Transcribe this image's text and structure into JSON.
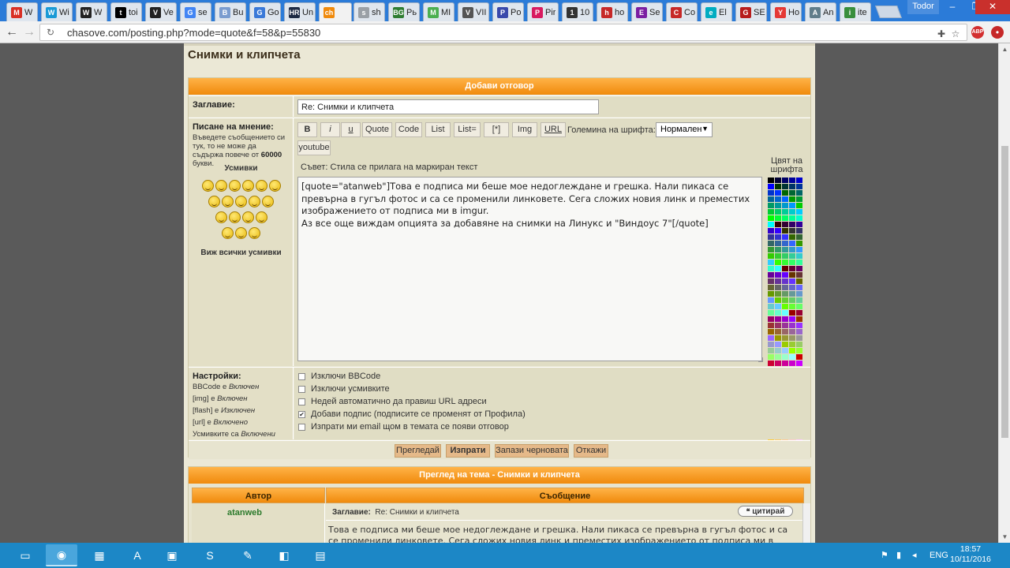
{
  "browser": {
    "tabs": [
      {
        "title": "W",
        "icon": "M",
        "color": "#d93025"
      },
      {
        "title": "Wi",
        "icon": "W",
        "color": "#1a9ad6"
      },
      {
        "title": "W",
        "icon": "W",
        "color": "#222222"
      },
      {
        "title": "toi",
        "icon": "t",
        "color": "#000000"
      },
      {
        "title": "Ve",
        "icon": "V",
        "color": "#222222"
      },
      {
        "title": "se",
        "icon": "G",
        "color": "#4285f4"
      },
      {
        "title": "Bu",
        "icon": "B",
        "color": "#7a9ccf"
      },
      {
        "title": "Go",
        "icon": "G",
        "color": "#3a79d8"
      },
      {
        "title": "Un",
        "icon": "HR",
        "color": "#1d2a44"
      },
      {
        "title": "",
        "icon": "ch",
        "color": "#f08a0c",
        "active": true
      },
      {
        "title": "sh",
        "icon": "s",
        "color": "#9aa0a6"
      },
      {
        "title": "Рь",
        "icon": "BG",
        "color": "#2e7d32"
      },
      {
        "title": "MI",
        "icon": "M",
        "color": "#4caf50"
      },
      {
        "title": "VII",
        "icon": "V",
        "color": "#555555"
      },
      {
        "title": "Po",
        "icon": "P",
        "color": "#3949ab"
      },
      {
        "title": "Pir",
        "icon": "P",
        "color": "#d81b60"
      },
      {
        "title": "10",
        "icon": "1",
        "color": "#333333"
      },
      {
        "title": "ho",
        "icon": "h",
        "color": "#c62828"
      },
      {
        "title": "Se",
        "icon": "E",
        "color": "#7b1fa2"
      },
      {
        "title": "Co",
        "icon": "C",
        "color": "#c62828"
      },
      {
        "title": "El",
        "icon": "e",
        "color": "#00acc1"
      },
      {
        "title": "SE",
        "icon": "G",
        "color": "#b71c1c"
      },
      {
        "title": "Ho",
        "icon": "Y",
        "color": "#e53935"
      },
      {
        "title": "An",
        "icon": "A",
        "color": "#607d8b"
      },
      {
        "title": "ite",
        "icon": "i",
        "color": "#388e3c"
      }
    ],
    "user": "Todor",
    "url": "chasove.com/posting.php?mode=quote&f=58&p=55830"
  },
  "page": {
    "section_title": "Снимки и клипчета",
    "form_header": "Добави отговор",
    "subject_label": "Заглавие:",
    "subject_value": "Re: Снимки и клипчета",
    "message_label": "Писане на мнение:",
    "message_hint_1": "Въведете съобщението си тук, то не може да съдържа повече от",
    "message_limit": "60000",
    "message_hint_2": "букви.",
    "smilies_title": "Усмивки",
    "smilies_more": "Виж всички усмивки",
    "bbcode_buttons": [
      "B",
      "i",
      "u",
      "Quote",
      "Code",
      "List",
      "List=",
      "[*]",
      "Img",
      "URL"
    ],
    "youtube_button": "youtube",
    "font_size_label": "Големина на шрифта:",
    "font_size_value": "Нормален",
    "tip": "Съвет: Стила се прилага на маркиран текст",
    "color_label": "Цвят на шрифта",
    "message_text": "[quote=\"atanweb\"]Това е подписа ми беше мое недоглеждане и грешка. Нали пикаса се превърна в гугъл фотос и са се променили линковете. Сега сложих новия линк и преместих изображението от подписа ми в imgur.\nАз все още виждам опцията за добавяне на снимки на Линукс и \"Виндоус 7\"[/quote]",
    "settings_label": "Настройки:",
    "settings_status": [
      {
        "name": "BBCode",
        "mid": "е",
        "value": "Включен"
      },
      {
        "name": "[img]",
        "mid": "е",
        "value": "Включен"
      },
      {
        "name": "[flash]",
        "mid": "е",
        "value": "Изключен"
      },
      {
        "name": "[url]",
        "mid": "е",
        "value": "Включено"
      },
      {
        "name": "Усмивките са",
        "mid": "",
        "value": "Включени"
      }
    ],
    "options": [
      {
        "label": "Изключи BBCode",
        "checked": false
      },
      {
        "label": "Изключи усмивките",
        "checked": false
      },
      {
        "label": "Недей автоматично да правиш URL адреси",
        "checked": false
      },
      {
        "label": "Добави подпис (подписите се променят от Профила)",
        "checked": true
      },
      {
        "label": "Изпрати ми email щом в темата се появи отговор",
        "checked": false
      }
    ],
    "buttons": {
      "preview": "Прегледай",
      "submit": "Изпрати",
      "save": "Запази черновата",
      "cancel": "Откажи"
    },
    "review_header": "Преглед на тема - Снимки и клипчета",
    "col_author": "Автор",
    "col_message": "Съобщение",
    "post_author": "atanweb",
    "post_subject_label": "Заглавие:",
    "post_subject": "Re: Снимки и клипчета",
    "quote_button": "цитирай",
    "post_text": "Това е подписа ми беше мое недоглеждане и грешка. Нали пикаса се превърна в гугъл фотос и са се променили линковете. Сега сложих новия линк и преместих изображението от подписа ми в imgur."
  },
  "taskbar": {
    "lang": "ENG",
    "time": "18:57",
    "date": "10/11/2016"
  }
}
